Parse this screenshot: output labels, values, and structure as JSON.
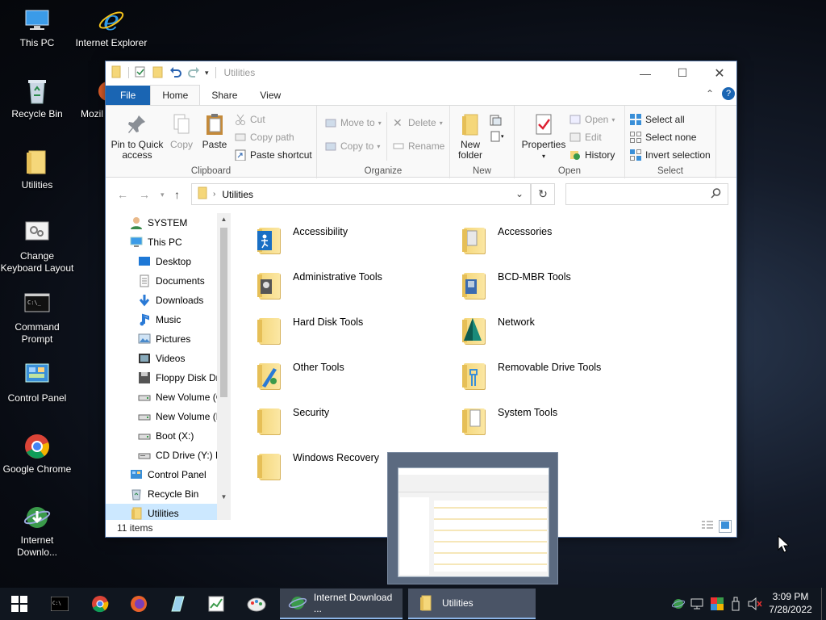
{
  "desktop_icons": [
    {
      "label": "This PC",
      "icon": "computer-icon"
    },
    {
      "label": "Internet Explorer",
      "icon": "internet-explorer-icon"
    },
    {
      "label": "Recycle Bin",
      "icon": "recycle-bin-icon"
    },
    {
      "label": "Mozil",
      "icon": "firefox-icon"
    },
    {
      "label": "Utilities",
      "icon": "folder-icon"
    },
    {
      "label": "Change Keyboard Layout",
      "icon": "keyboard-settings-icon"
    },
    {
      "label": "Command Prompt",
      "icon": "command-prompt-icon"
    },
    {
      "label": "Control Panel",
      "icon": "control-panel-icon"
    },
    {
      "label": "Google Chrome",
      "icon": "chrome-icon"
    },
    {
      "label": "Internet Downlo...",
      "icon": "idm-icon"
    }
  ],
  "window": {
    "title": "Utilities"
  },
  "ribbon": {
    "tabs": [
      "File",
      "Home",
      "Share",
      "View"
    ],
    "clipboard": {
      "pin": "Pin to Quick access",
      "copy": "Copy",
      "paste": "Paste",
      "cut": "Cut",
      "copy_path": "Copy path",
      "paste_shortcut": "Paste shortcut",
      "label": "Clipboard"
    },
    "organize": {
      "move_to": "Move to",
      "copy_to": "Copy to",
      "delete": "Delete",
      "rename": "Rename",
      "label": "Organize"
    },
    "new": {
      "new_folder": "New folder",
      "label": "New"
    },
    "open": {
      "properties": "Properties",
      "open": "Open",
      "edit": "Edit",
      "history": "History",
      "label": "Open"
    },
    "select": {
      "select_all": "Select all",
      "select_none": "Select none",
      "invert": "Invert selection",
      "label": "Select"
    }
  },
  "address": {
    "path": "Utilities",
    "search_placeholder": ""
  },
  "nav_items": [
    {
      "label": "SYSTEM",
      "icon": "user-icon",
      "indent": 0
    },
    {
      "label": "This PC",
      "icon": "computer-icon",
      "indent": 0
    },
    {
      "label": "Desktop",
      "icon": "desktop-icon",
      "indent": 1
    },
    {
      "label": "Documents",
      "icon": "documents-icon",
      "indent": 1
    },
    {
      "label": "Downloads",
      "icon": "downloads-icon",
      "indent": 1
    },
    {
      "label": "Music",
      "icon": "music-icon",
      "indent": 1
    },
    {
      "label": "Pictures",
      "icon": "pictures-icon",
      "indent": 1
    },
    {
      "label": "Videos",
      "icon": "videos-icon",
      "indent": 1
    },
    {
      "label": "Floppy Disk Dri",
      "icon": "floppy-icon",
      "indent": 1
    },
    {
      "label": "New Volume (C",
      "icon": "drive-icon",
      "indent": 1
    },
    {
      "label": "New Volume (D",
      "icon": "drive-icon",
      "indent": 1
    },
    {
      "label": "Boot (X:)",
      "icon": "drive-icon",
      "indent": 1
    },
    {
      "label": "CD Drive (Y:) H",
      "icon": "cd-drive-icon",
      "indent": 1
    },
    {
      "label": "Control Panel",
      "icon": "control-panel-icon",
      "indent": 0
    },
    {
      "label": "Recycle Bin",
      "icon": "recycle-bin-icon",
      "indent": 0
    },
    {
      "label": "Utilities",
      "icon": "folder-icon",
      "indent": 0,
      "selected": true
    }
  ],
  "files": [
    {
      "name": "Accessibility"
    },
    {
      "name": "Accessories"
    },
    {
      "name": "Administrative Tools"
    },
    {
      "name": "BCD-MBR Tools"
    },
    {
      "name": "Hard Disk Tools"
    },
    {
      "name": "Network"
    },
    {
      "name": "Other Tools"
    },
    {
      "name": "Removable Drive Tools"
    },
    {
      "name": "Security"
    },
    {
      "name": "System Tools"
    },
    {
      "name": "Windows Recovery"
    }
  ],
  "status": {
    "count": "11 items"
  },
  "taskbar": {
    "windows": [
      {
        "label": "Internet Download ..."
      },
      {
        "label": "Utilities"
      }
    ],
    "clock": {
      "time": "3:09 PM",
      "date": "7/28/2022"
    }
  },
  "colors": {
    "accent": "#1a65b3",
    "folder": "#f5d77a",
    "taskbar": "#10161f"
  }
}
